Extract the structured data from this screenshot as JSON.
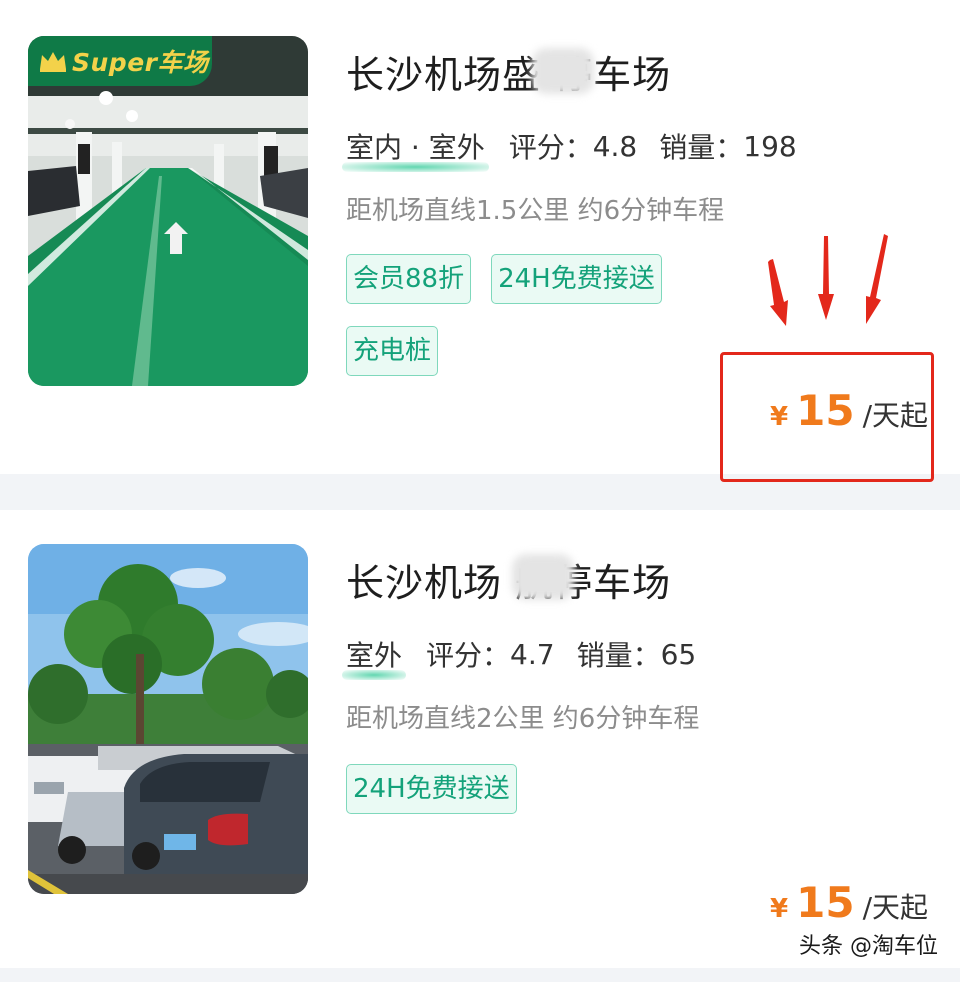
{
  "listings": [
    {
      "badge": "Super车场",
      "title": "长沙机场盛 停车场",
      "environment": "室内 · 室外",
      "rating_label": "评分：",
      "rating": "4.8",
      "sales_label": "销量：",
      "sales": "198",
      "distance": "距机场直线1.5公里 约6分钟车程",
      "tags": [
        "会员88折",
        "24H免费接送",
        "充电桩"
      ],
      "price_symbol": "¥",
      "price": "15",
      "price_unit": "/天起"
    },
    {
      "title": "长沙机场 航停车场",
      "environment": "室外",
      "rating_label": "评分：",
      "rating": "4.7",
      "sales_label": "销量：",
      "sales": "65",
      "distance": "距机场直线2公里 约6分钟车程",
      "tags": [
        "24H免费接送"
      ],
      "price_symbol": "¥",
      "price": "15",
      "price_unit": "/天起"
    }
  ],
  "watermark": "头条 @淘车位",
  "colors": {
    "accent_green": "#14a27a",
    "price_orange": "#f07a1c",
    "annotation_red": "#e3281b",
    "badge_green": "#0f7a47"
  },
  "icons": [
    "crown-icon",
    "down-arrow-annotation-icon"
  ]
}
